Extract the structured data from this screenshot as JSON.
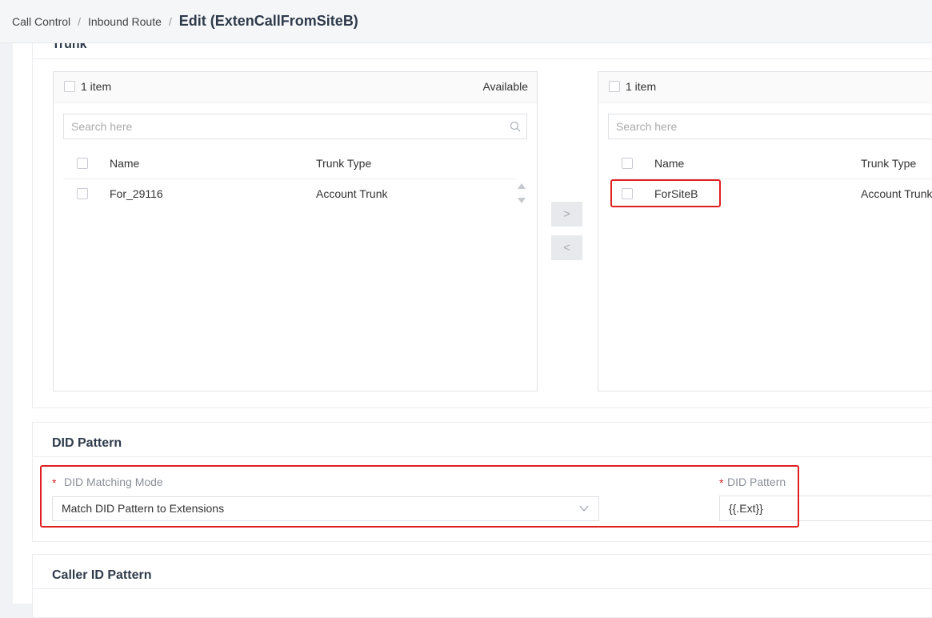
{
  "breadcrumb": {
    "items": [
      "Call Control",
      "Inbound Route"
    ],
    "current": "Edit (ExtenCallFromSiteB)"
  },
  "trunk": {
    "title": "Trunk",
    "available": {
      "count": "1 item",
      "label": "Available",
      "search_placeholder": "Search here",
      "columns": [
        "Name",
        "Trunk Type"
      ],
      "rows": [
        {
          "name": "For_29116",
          "type": "Account Trunk"
        }
      ]
    },
    "selected": {
      "count": "1 item",
      "search_placeholder": "Search here",
      "columns": [
        "Name",
        "Trunk Type"
      ],
      "rows": [
        {
          "name": "ForSiteB",
          "type": "Account Trunk"
        }
      ]
    },
    "move_right": ">",
    "move_left": "<"
  },
  "did": {
    "title": "DID Pattern",
    "required_mark": "*",
    "mode_label": "DID Matching Mode",
    "mode_value": "Match DID Pattern to Extensions",
    "pattern_label": "DID Pattern",
    "pattern_value": "{{.Ext}}"
  },
  "caller": {
    "title": "Caller ID Pattern"
  },
  "colors": {
    "highlight": "#e02020",
    "heading": "#2f3a4a"
  }
}
